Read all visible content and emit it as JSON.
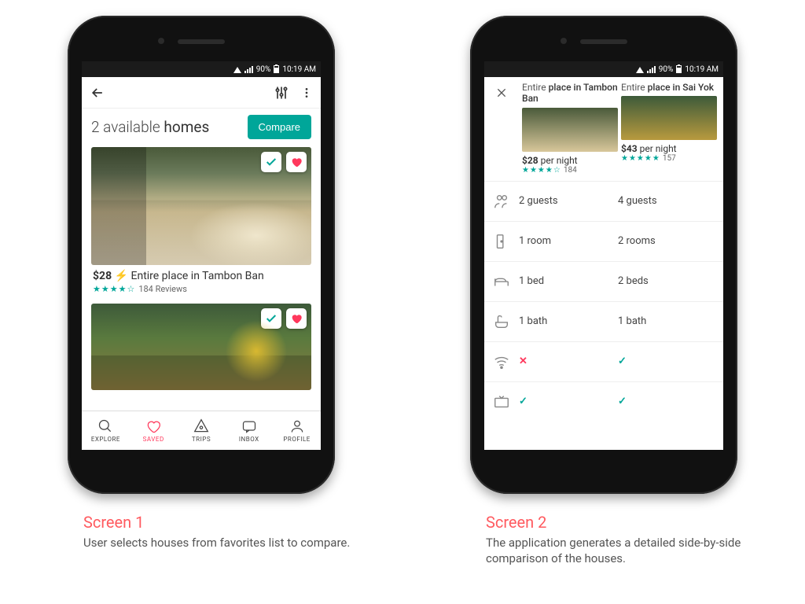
{
  "status": {
    "battery": "90%",
    "time": "10:19 AM"
  },
  "screen1": {
    "title_count": "2 available",
    "title_word": "homes",
    "compare_label": "Compare",
    "listing1": {
      "price": "$28",
      "desc": "Entire place in Tambon Ban",
      "stars": "★★★★☆",
      "reviews": "184 Reviews"
    },
    "tabs": {
      "explore": "EXPLORE",
      "saved": "SAVED",
      "trips": "TRIPS",
      "inbox": "INBOX",
      "profile": "PROFILE"
    }
  },
  "screen2": {
    "colA": {
      "name_pre": "Entire",
      "name_rest": "place in Tambon Ban",
      "price": "$28",
      "per": "per night",
      "stars": "★★★★☆",
      "reviews": "184"
    },
    "colB": {
      "name_pre": "Entire",
      "name_rest": "place in Sai Yok",
      "price": "$43",
      "per": "per night",
      "stars": "★★★★★",
      "reviews": "157"
    },
    "rows": {
      "guestsA": "2 guests",
      "guestsB": "4 guests",
      "roomsA": "1 room",
      "roomsB": "2 rooms",
      "bedsA": "1 bed",
      "bedsB": "2 beds",
      "bathA": "1 bath",
      "bathB": "1 bath",
      "wifiA": "✕",
      "wifiB": "✓"
    }
  },
  "captions": {
    "s1_h": "Screen 1",
    "s1_d": "User selects houses from favorites list to compare.",
    "s2_h": "Screen 2",
    "s2_d": "The application generates a detailed side-by-side comparison of the houses."
  }
}
